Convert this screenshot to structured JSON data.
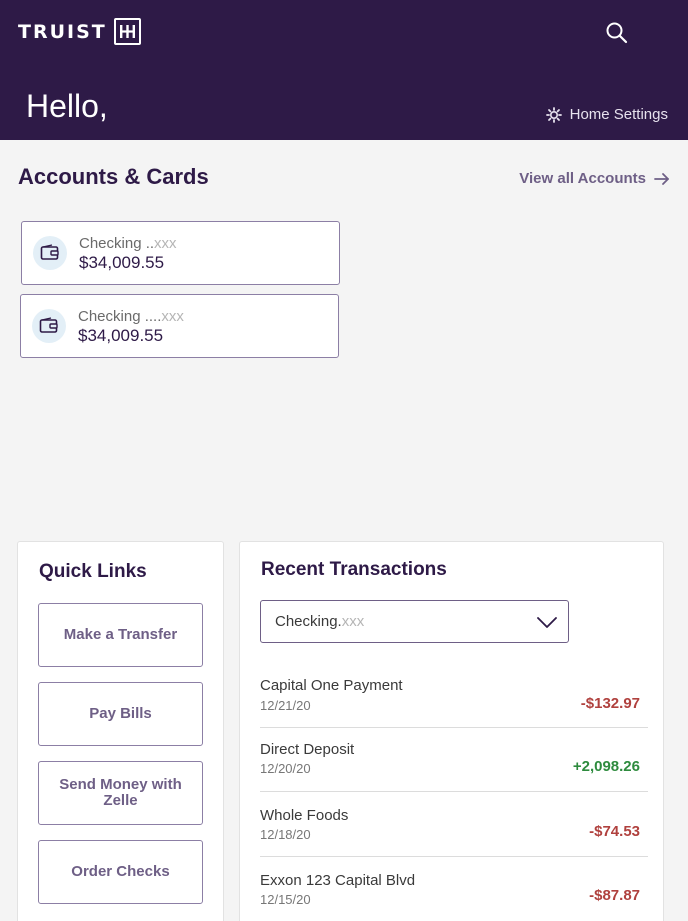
{
  "header": {
    "logo_text": "TRUIST",
    "greeting": "Hello,",
    "home_settings_label": "Home Settings"
  },
  "accounts": {
    "title": "Accounts & Cards",
    "view_all_label": "View all Accounts",
    "items": [
      {
        "name": "Checking ..",
        "mask": "xxx",
        "balance": "$34,009.55"
      },
      {
        "name": "Checking ....",
        "mask": "xxx",
        "balance": "$34,009.55"
      }
    ]
  },
  "quick_links": {
    "title": "Quick Links",
    "items": [
      {
        "label": "Make a Transfer"
      },
      {
        "label": "Pay Bills"
      },
      {
        "label": "Send Money with Zelle"
      },
      {
        "label": "Order Checks"
      }
    ]
  },
  "transactions": {
    "title": "Recent Transactions",
    "selected_account": {
      "name": "Checking.",
      "mask": "xxx"
    },
    "items": [
      {
        "name": "Capital One Payment",
        "date": "12/21/20",
        "amount": "-$132.97",
        "type": "debit"
      },
      {
        "name": "Direct Deposit",
        "date": "12/20/20",
        "amount": "+2,098.26",
        "type": "credit"
      },
      {
        "name": "Whole Foods",
        "date": "12/18/20",
        "amount": "-$74.53",
        "type": "debit"
      },
      {
        "name": "Exxon 123 Capital Blvd",
        "date": "12/15/20",
        "amount": "-$87.87",
        "type": "debit"
      }
    ]
  },
  "colors": {
    "brand_purple": "#2e1a47",
    "link_purple": "#6e5f86",
    "debit_red": "#b0413e",
    "credit_green": "#2e8b3e"
  },
  "icons": {
    "search": "search-icon",
    "settings": "gear-icon",
    "wallet": "wallet-icon",
    "view_all": "arrow-right-icon",
    "dropdown": "chevron-down-icon"
  }
}
